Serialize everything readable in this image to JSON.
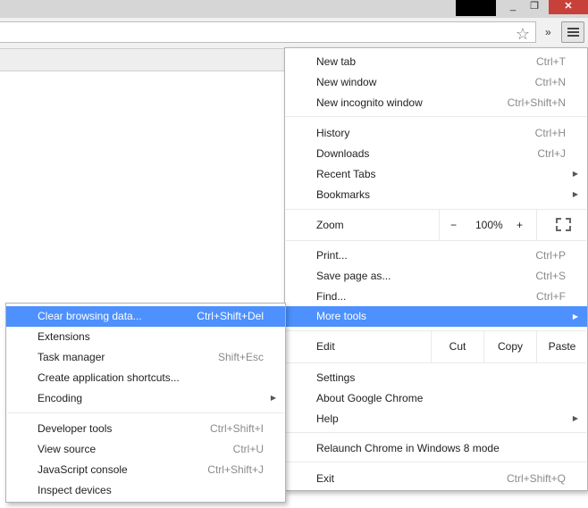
{
  "window": {
    "minimize_glyph": "_",
    "maximize_glyph": "❐",
    "close_glyph": "✕"
  },
  "toolbar": {
    "star_icon": "star-icon",
    "star_glyph": "☆",
    "extensions_chevron": "»",
    "menu_icon": "hamburger-icon"
  },
  "main_menu": {
    "new_tab": {
      "label": "New tab",
      "shortcut": "Ctrl+T"
    },
    "new_window": {
      "label": "New window",
      "shortcut": "Ctrl+N"
    },
    "new_incognito": {
      "label": "New incognito window",
      "shortcut": "Ctrl+Shift+N"
    },
    "history": {
      "label": "History",
      "shortcut": "Ctrl+H"
    },
    "downloads": {
      "label": "Downloads",
      "shortcut": "Ctrl+J"
    },
    "recent_tabs": {
      "label": "Recent Tabs"
    },
    "bookmarks": {
      "label": "Bookmarks"
    },
    "zoom": {
      "label": "Zoom",
      "minus": "−",
      "value": "100%",
      "plus": "+"
    },
    "print": {
      "label": "Print...",
      "shortcut": "Ctrl+P"
    },
    "save_page": {
      "label": "Save page as...",
      "shortcut": "Ctrl+S"
    },
    "find": {
      "label": "Find...",
      "shortcut": "Ctrl+F"
    },
    "more_tools": {
      "label": "More tools"
    },
    "edit": {
      "label": "Edit",
      "cut": "Cut",
      "copy": "Copy",
      "paste": "Paste"
    },
    "settings": {
      "label": "Settings"
    },
    "about": {
      "label": "About Google Chrome"
    },
    "help": {
      "label": "Help"
    },
    "relaunch": {
      "label": "Relaunch Chrome in Windows 8 mode"
    },
    "exit": {
      "label": "Exit",
      "shortcut": "Ctrl+Shift+Q"
    },
    "submenu_arrow": "▶"
  },
  "more_tools_menu": {
    "clear_browsing": {
      "label": "Clear browsing data...",
      "shortcut": "Ctrl+Shift+Del"
    },
    "extensions": {
      "label": "Extensions"
    },
    "task_manager": {
      "label": "Task manager",
      "shortcut": "Shift+Esc"
    },
    "app_shortcuts": {
      "label": "Create application shortcuts..."
    },
    "encoding": {
      "label": "Encoding"
    },
    "developer_tools": {
      "label": "Developer tools",
      "shortcut": "Ctrl+Shift+I"
    },
    "view_source": {
      "label": "View source",
      "shortcut": "Ctrl+U"
    },
    "js_console": {
      "label": "JavaScript console",
      "shortcut": "Ctrl+Shift+J"
    },
    "inspect_devices": {
      "label": "Inspect devices"
    }
  },
  "colors": {
    "highlight": "#4d90fe",
    "close_button": "#c7413a",
    "shortcut_text": "#8a8a8a"
  }
}
